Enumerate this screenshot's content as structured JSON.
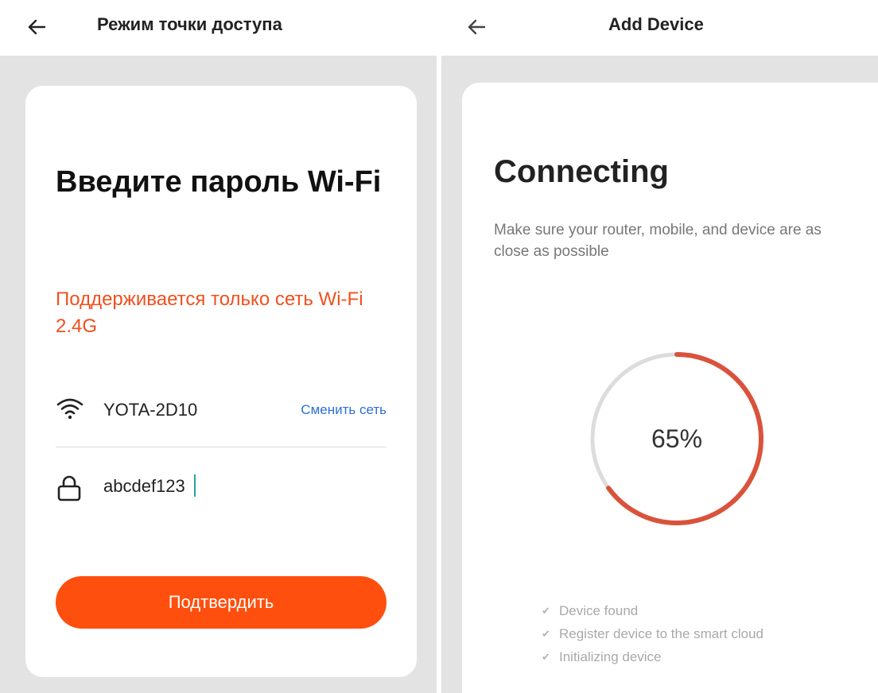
{
  "left_screen": {
    "title": "Режим точки доступа",
    "heading": "Введите пароль Wi-Fi",
    "warning": "Поддерживается только сеть Wi-Fi 2.4G",
    "network": {
      "icon": "wifi-icon",
      "ssid": "YOTA-2D10",
      "change_label": "Сменить сеть"
    },
    "password": {
      "icon": "lock-icon",
      "value": "abcdef123"
    },
    "confirm_label": "Подтвердить",
    "accent_color": "#ff4f0f",
    "link_color": "#2e6fd8"
  },
  "right_screen": {
    "title": "Add Device",
    "heading": "Connecting",
    "description": "Make sure your router, mobile, and device are as close as possible",
    "progress": {
      "value": 65,
      "label": "65%",
      "color": "#d9533c",
      "track_color": "#dcdcdc"
    },
    "steps": [
      {
        "icon": "check-icon",
        "label": "Device found"
      },
      {
        "icon": "check-icon",
        "label": "Register device to the smart cloud"
      },
      {
        "icon": "check-icon",
        "label": "Initializing device"
      }
    ]
  }
}
